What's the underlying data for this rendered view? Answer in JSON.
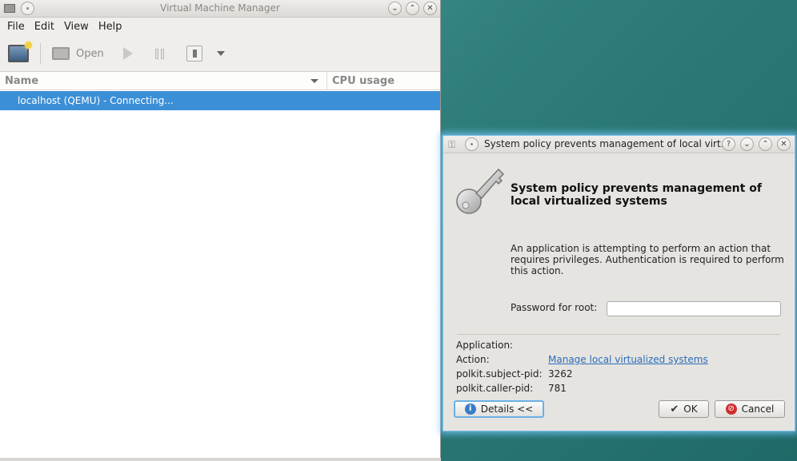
{
  "main_window": {
    "title": "Virtual Machine Manager",
    "menu": [
      "File",
      "Edit",
      "View",
      "Help"
    ],
    "toolbar": {
      "open_label": "Open"
    },
    "columns": {
      "name": "Name",
      "cpu": "CPU usage"
    },
    "rows": [
      {
        "label": "localhost (QEMU) - Connecting..."
      }
    ]
  },
  "dialog": {
    "title": "System policy prevents management of local virt...",
    "heading": "System policy prevents management of local virtualized systems",
    "message": "An application is attempting to perform an action that requires privileges. Authentication is required to perform this action.",
    "password_label": "Password for root:",
    "password_value": "",
    "details": {
      "application_label": "Application:",
      "application_value": "",
      "action_label": "Action:",
      "action_value": "Manage local virtualized systems",
      "subject_pid_label": "polkit.subject-pid:",
      "subject_pid_value": "3262",
      "caller_pid_label": "polkit.caller-pid:",
      "caller_pid_value": "781"
    },
    "buttons": {
      "details": "Details <<",
      "ok": "OK",
      "cancel": "Cancel"
    }
  },
  "colors": {
    "selection": "#3b8fd6",
    "link": "#2a6db8",
    "focus_glow": "#7fc0e6"
  },
  "icons": [
    "app-icon",
    "pin-icon",
    "minimize-icon",
    "maximize-icon",
    "close-icon",
    "new-vm-icon",
    "monitor-icon",
    "play-icon",
    "pause-icon",
    "shutdown-icon",
    "dropdown-icon",
    "key-icon",
    "help-icon",
    "info-icon",
    "check-icon",
    "cancel-icon"
  ]
}
